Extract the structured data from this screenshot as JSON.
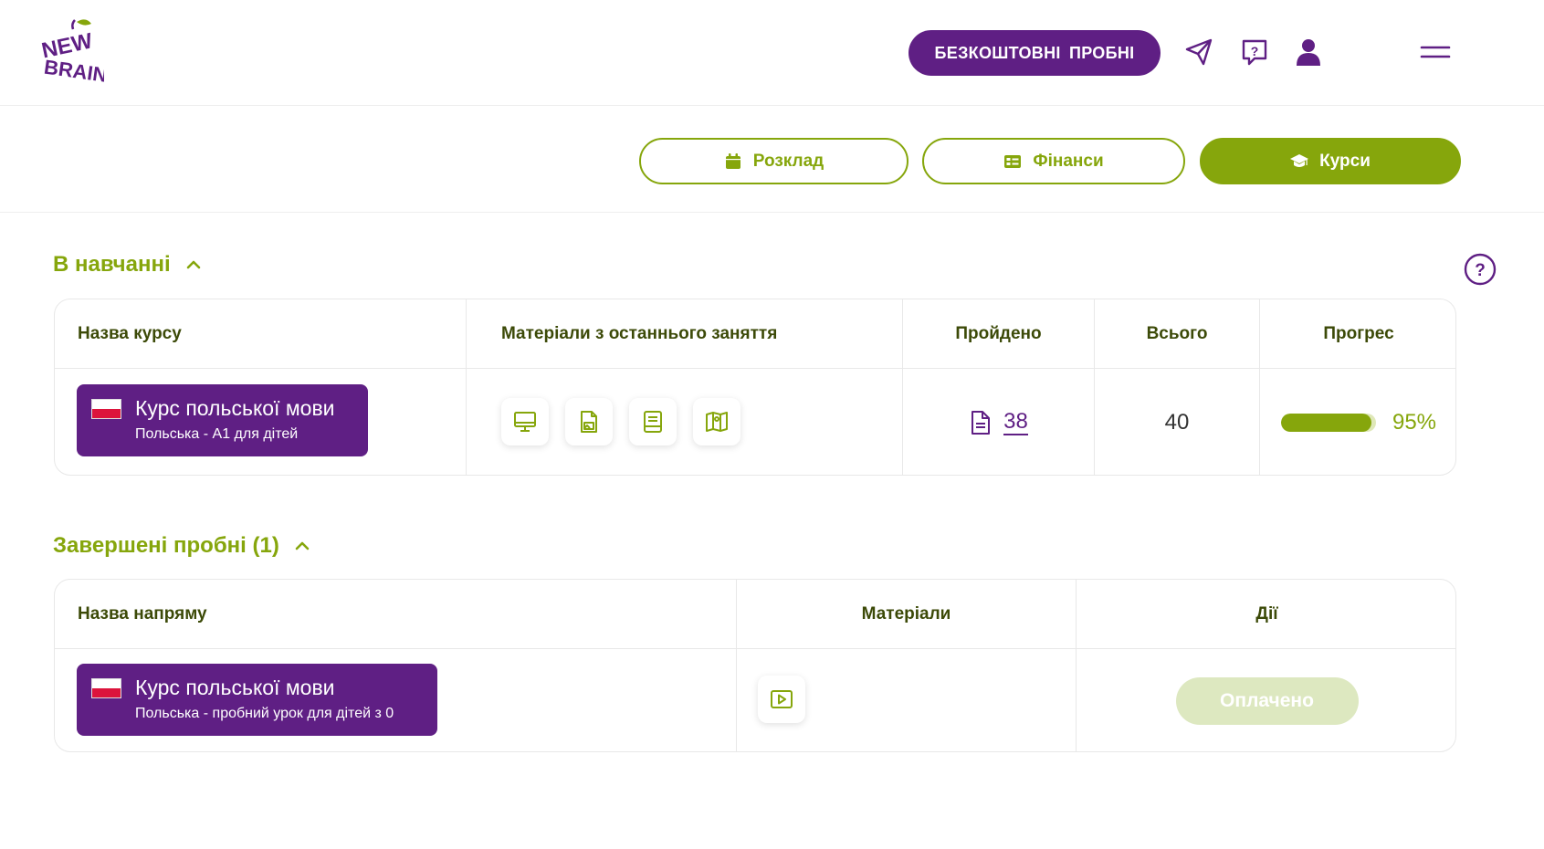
{
  "header": {
    "logo_text": "NEW BRAIN",
    "trials_button": "БЕЗКОШТОВНІ  ПРОБНІ",
    "icons": [
      "send-icon",
      "help-chat-icon",
      "user-icon",
      "menu-icon"
    ]
  },
  "tabs": [
    {
      "label": "Розклад",
      "icon": "calendar-icon",
      "active": false
    },
    {
      "label": "Фінанси",
      "icon": "finance-icon",
      "active": false
    },
    {
      "label": "Курси",
      "icon": "graduation-cap-icon",
      "active": true
    }
  ],
  "studying": {
    "title": "В навчанні",
    "columns": [
      "Назва курсу",
      "Матеріали з останнього заняття",
      "Пройдено",
      "Всього",
      "Прогрес"
    ],
    "rows": [
      {
        "course_title": "Курс польської мови",
        "course_sub": "Польська - А1 для дітей",
        "materials": [
          "presentation-icon",
          "document-image-icon",
          "notebook-icon",
          "book-map-icon"
        ],
        "passed": "38",
        "total": "40",
        "progress_percent": 95,
        "progress_label": "95%"
      }
    ]
  },
  "trials": {
    "title": "Завершені пробні (1)",
    "columns": [
      "Назва напряму",
      "Матеріали",
      "Дії"
    ],
    "rows": [
      {
        "course_title": "Курс польської мови",
        "course_sub": "Польська - пробний урок для дітей з 0",
        "materials": [
          "video-icon"
        ],
        "action_label": "Оплачено"
      }
    ]
  },
  "colors": {
    "brand_purple": "#5f1f84",
    "brand_green": "#86a60c",
    "paid_button_bg": "#dde8c0"
  }
}
